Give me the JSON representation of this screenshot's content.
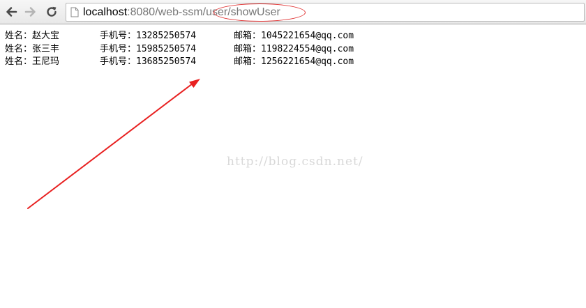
{
  "browser": {
    "url_host": "localhost",
    "url_rest": ":8080/web-ssm/user/showUser",
    "icons": {
      "back": "back-arrow-icon",
      "forward": "forward-arrow-icon",
      "reload": "reload-icon",
      "page": "page-icon"
    }
  },
  "users": [
    {
      "name_label": "姓名：",
      "name": "赵大宝",
      "phone_label": "手机号：",
      "phone": "13285250574",
      "email_label": "邮箱：",
      "email": "1045221654@qq.com"
    },
    {
      "name_label": "姓名：",
      "name": "张三丰",
      "phone_label": "手机号：",
      "phone": "15985250574",
      "email_label": "邮箱：",
      "email": "1198224554@qq.com"
    },
    {
      "name_label": "姓名：",
      "name": "王尼玛",
      "phone_label": "手机号：",
      "phone": "13685250574",
      "email_label": "邮箱：",
      "email": "1256221654@qq.com"
    }
  ],
  "watermark": "http://blog.csdn.net/",
  "colors": {
    "annotation": "#e82020"
  }
}
